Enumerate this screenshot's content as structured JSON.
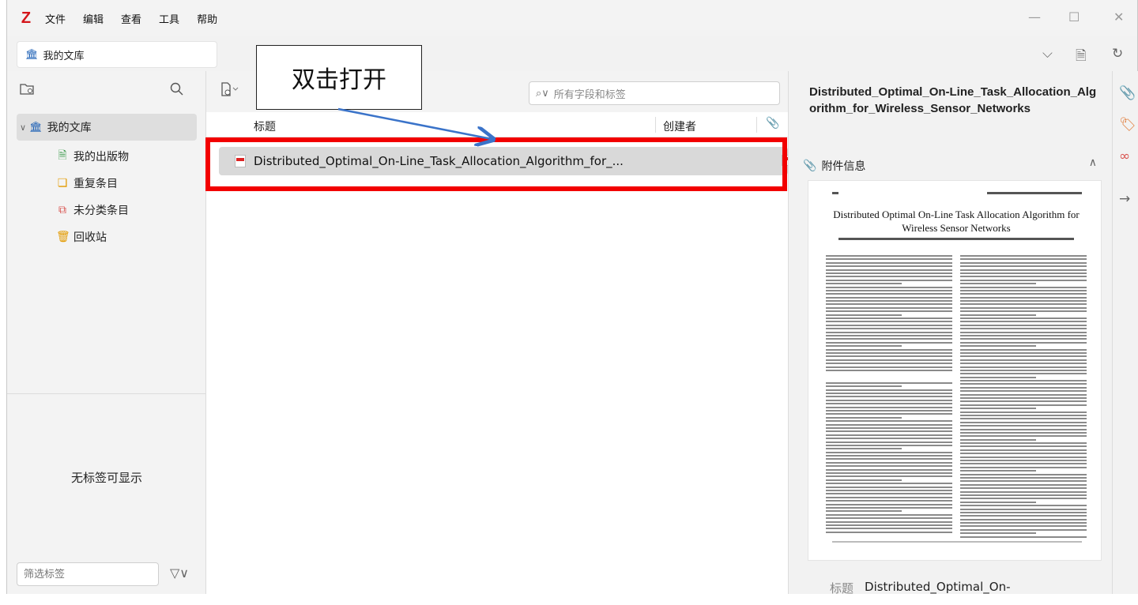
{
  "app": {
    "logo": "Z"
  },
  "menu": [
    "文件",
    "编辑",
    "查看",
    "工具",
    "帮助"
  ],
  "window_controls": {
    "minimize": "—",
    "maximize": "☐",
    "close": "✕"
  },
  "tabs": [
    {
      "label": "我的文库"
    }
  ],
  "left_pane": {
    "root": "我的文库",
    "items": [
      {
        "label": "我的出版物",
        "icon": "publications-icon",
        "color": "#3a9a4a"
      },
      {
        "label": "重复条目",
        "icon": "duplicates-icon",
        "color": "#e39a00"
      },
      {
        "label": "未分类条目",
        "icon": "unfiled-icon",
        "color": "#d9534f"
      },
      {
        "label": "回收站",
        "icon": "trash-icon",
        "color": "#e39a00"
      }
    ],
    "tags_empty": "无标签可显示",
    "tag_filter_placeholder": "筛选标签"
  },
  "middle_pane": {
    "search_placeholder": "所有字段和标签",
    "columns": {
      "title": "标题",
      "creator": "创建者"
    },
    "rows": [
      {
        "title": "Distributed_Optimal_On-Line_Task_Allocation_Algorithm_for_...",
        "creator": ""
      }
    ]
  },
  "annotation": {
    "text": "双击打开",
    "highlight_color": "#f20000",
    "arrow_color": "#3a73c9"
  },
  "right_pane": {
    "item_title": "Distributed_Optimal_On-Line_Task_Allocation_Algorithm_for_Wireless_Sensor_Networks",
    "section": "附件信息",
    "preview_title": "Distributed Optimal On-Line Task Allocation Algorithm for Wireless Sensor Networks",
    "field_label": "标题",
    "field_value": "Distributed_Optimal_On-"
  },
  "colors": {
    "accent": "#1b5fb5",
    "brand": "#d4151a"
  }
}
